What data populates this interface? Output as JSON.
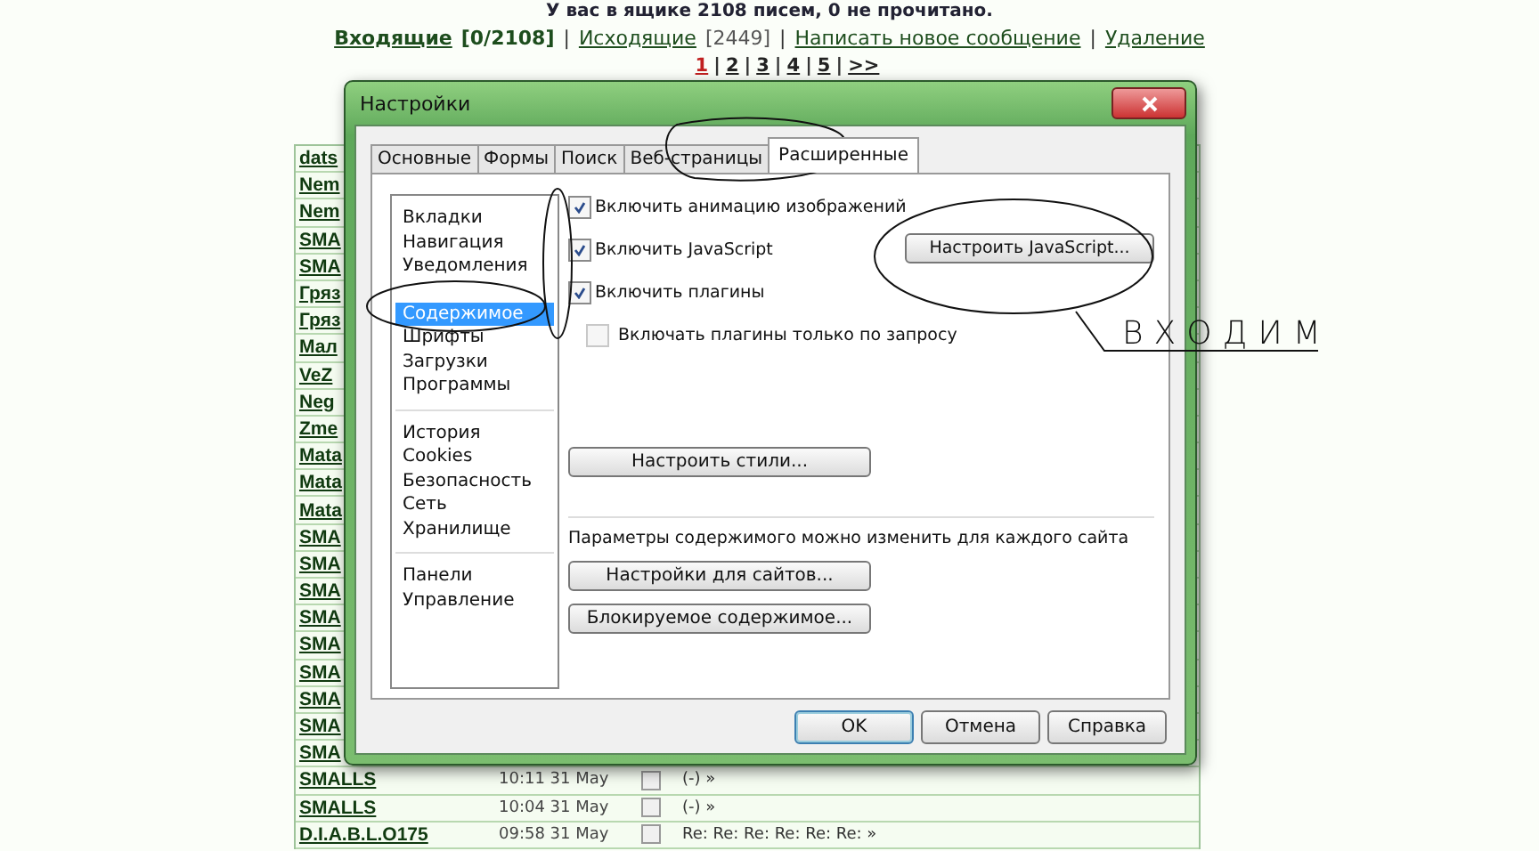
{
  "summary": "У вас в ящике 2108 писем, 0 не прочитано.",
  "nav_separator": "|",
  "nav": [
    {
      "label": "Входящие",
      "count": "[0/2108]",
      "selected": true
    },
    {
      "label": "Исходящие",
      "count": "[2449]",
      "selected": false
    },
    {
      "label": "Написать новое сообщение",
      "selected": false
    },
    {
      "label": "Удаление",
      "selected": false
    }
  ],
  "pages": [
    {
      "label": "1",
      "selected": true
    },
    {
      "label": "2",
      "selected": false
    },
    {
      "label": "3",
      "selected": false
    },
    {
      "label": "4",
      "selected": false
    },
    {
      "label": "5",
      "selected": false
    },
    {
      "label": ">>",
      "selected": false
    }
  ],
  "messages": [
    {
      "sender": "dats"
    },
    {
      "sender": "Nem"
    },
    {
      "sender": "Nem"
    },
    {
      "sender": "SMA"
    },
    {
      "sender": "SMA"
    },
    {
      "sender": "Гряз"
    },
    {
      "sender": "Гряз"
    },
    {
      "sender": "Мал"
    },
    {
      "sender": "VeZ"
    },
    {
      "sender": "Neg"
    },
    {
      "sender": "Zme"
    },
    {
      "sender": "Mata"
    },
    {
      "sender": "Mata"
    },
    {
      "sender": "Mata"
    },
    {
      "sender": "SMA"
    },
    {
      "sender": "SMA"
    },
    {
      "sender": "SMA"
    },
    {
      "sender": "SMA"
    },
    {
      "sender": "SMA"
    },
    {
      "sender": "SMA"
    },
    {
      "sender": "SMA"
    },
    {
      "sender": "SMA"
    },
    {
      "sender": "SMA"
    },
    {
      "sender": "SMALLS",
      "time": "10:11 31 May",
      "checked": false,
      "subject": "(-) »"
    },
    {
      "sender": "SMALLS",
      "time": "10:04 31 May",
      "checked": false,
      "subject": "(-) »"
    },
    {
      "sender": "D.I.A.B.L.O175",
      "time": "09:58 31 May",
      "checked": false,
      "subject": "Re: Re: Re: Re: Re: Re: »"
    }
  ],
  "dialog": {
    "title": "Настройки",
    "tabs": [
      {
        "label": "Основные",
        "selected": false
      },
      {
        "label": "Формы",
        "selected": false
      },
      {
        "label": "Поиск",
        "selected": false
      },
      {
        "label": "Веб-страницы",
        "selected": false
      },
      {
        "label": "Расширенные",
        "selected": true
      }
    ],
    "category_groups": [
      [
        {
          "label": "Вкладки",
          "selected": false
        },
        {
          "label": "Навигация",
          "selected": false
        },
        {
          "label": "Уведомления",
          "selected": false
        },
        {
          "label": "Содержимое",
          "selected": true
        },
        {
          "label": "Шрифты",
          "selected": false
        },
        {
          "label": "Загрузки",
          "selected": false
        },
        {
          "label": "Программы",
          "selected": false
        }
      ],
      [
        {
          "label": "История",
          "selected": false
        },
        {
          "label": "Cookies",
          "selected": false
        },
        {
          "label": "Безопасность",
          "selected": false
        },
        {
          "label": "Сеть",
          "selected": false
        },
        {
          "label": "Хранилище",
          "selected": false
        }
      ],
      [
        {
          "label": "Панели",
          "selected": false
        },
        {
          "label": "Управление",
          "selected": false
        }
      ]
    ],
    "options": [
      {
        "label": "Включить анимацию изображений",
        "checked": true,
        "disabled": false
      },
      {
        "label": "Включить JavaScript",
        "checked": true,
        "disabled": false
      },
      {
        "label": "Включить плагины",
        "checked": true,
        "disabled": false
      },
      {
        "label": "Включать плагины только по запросу",
        "checked": false,
        "disabled": true
      }
    ],
    "js_button": "Настроить JavaScript...",
    "styles_button": "Настроить стили...",
    "site_note": "Параметры содержимого можно изменить для каждого сайта",
    "site_buttons": [
      "Настройки для сайтов...",
      "Блокируемое содержимое..."
    ],
    "footer_buttons": [
      {
        "label": "OK",
        "default": true
      },
      {
        "label": "Отмена",
        "default": false
      },
      {
        "label": "Справка",
        "default": false
      }
    ]
  },
  "annotation": {
    "text": "ВХОДИМ"
  }
}
